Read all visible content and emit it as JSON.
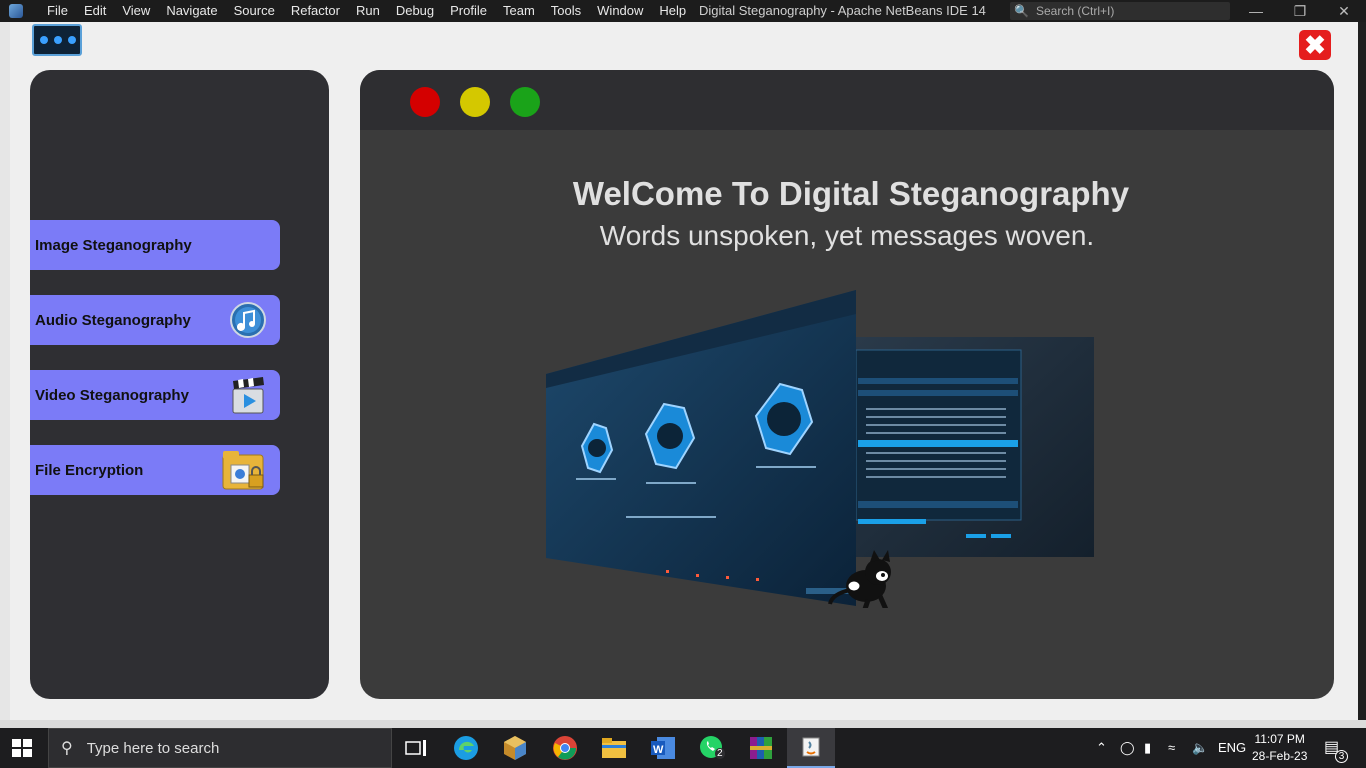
{
  "ide": {
    "menu": [
      "File",
      "Edit",
      "View",
      "Navigate",
      "Source",
      "Refactor",
      "Run",
      "Debug",
      "Profile",
      "Team",
      "Tools",
      "Window",
      "Help"
    ],
    "title": "Digital Steganography - Apache NetBeans IDE 14",
    "search_placeholder": "Search (Ctrl+I)"
  },
  "sidebar": {
    "items": [
      {
        "label": "Image Steganography",
        "icon": "none"
      },
      {
        "label": "Audio Steganography",
        "icon": "music-note-icon"
      },
      {
        "label": "Video Steganography",
        "icon": "clapperboard-icon"
      },
      {
        "label": "File Encryption",
        "icon": "folder-lock-icon"
      }
    ]
  },
  "main": {
    "window_dots": [
      "#d40000",
      "#d4c800",
      "#1aa319"
    ],
    "headline": "WelCome To Digital Steganography",
    "subline": "Words unspoken, yet messages woven."
  },
  "taskbar": {
    "search_placeholder": "Type here to search",
    "whatsapp_badge": "2",
    "language": "ENG",
    "time": "11:07 PM",
    "date": "28-Feb-23",
    "notification_count": "3"
  },
  "colors": {
    "sidebar_button": "#7b7bf7",
    "close_button": "#e51d1d",
    "panel_bg": "#2f2f33",
    "main_bg": "#3b3b3b"
  }
}
